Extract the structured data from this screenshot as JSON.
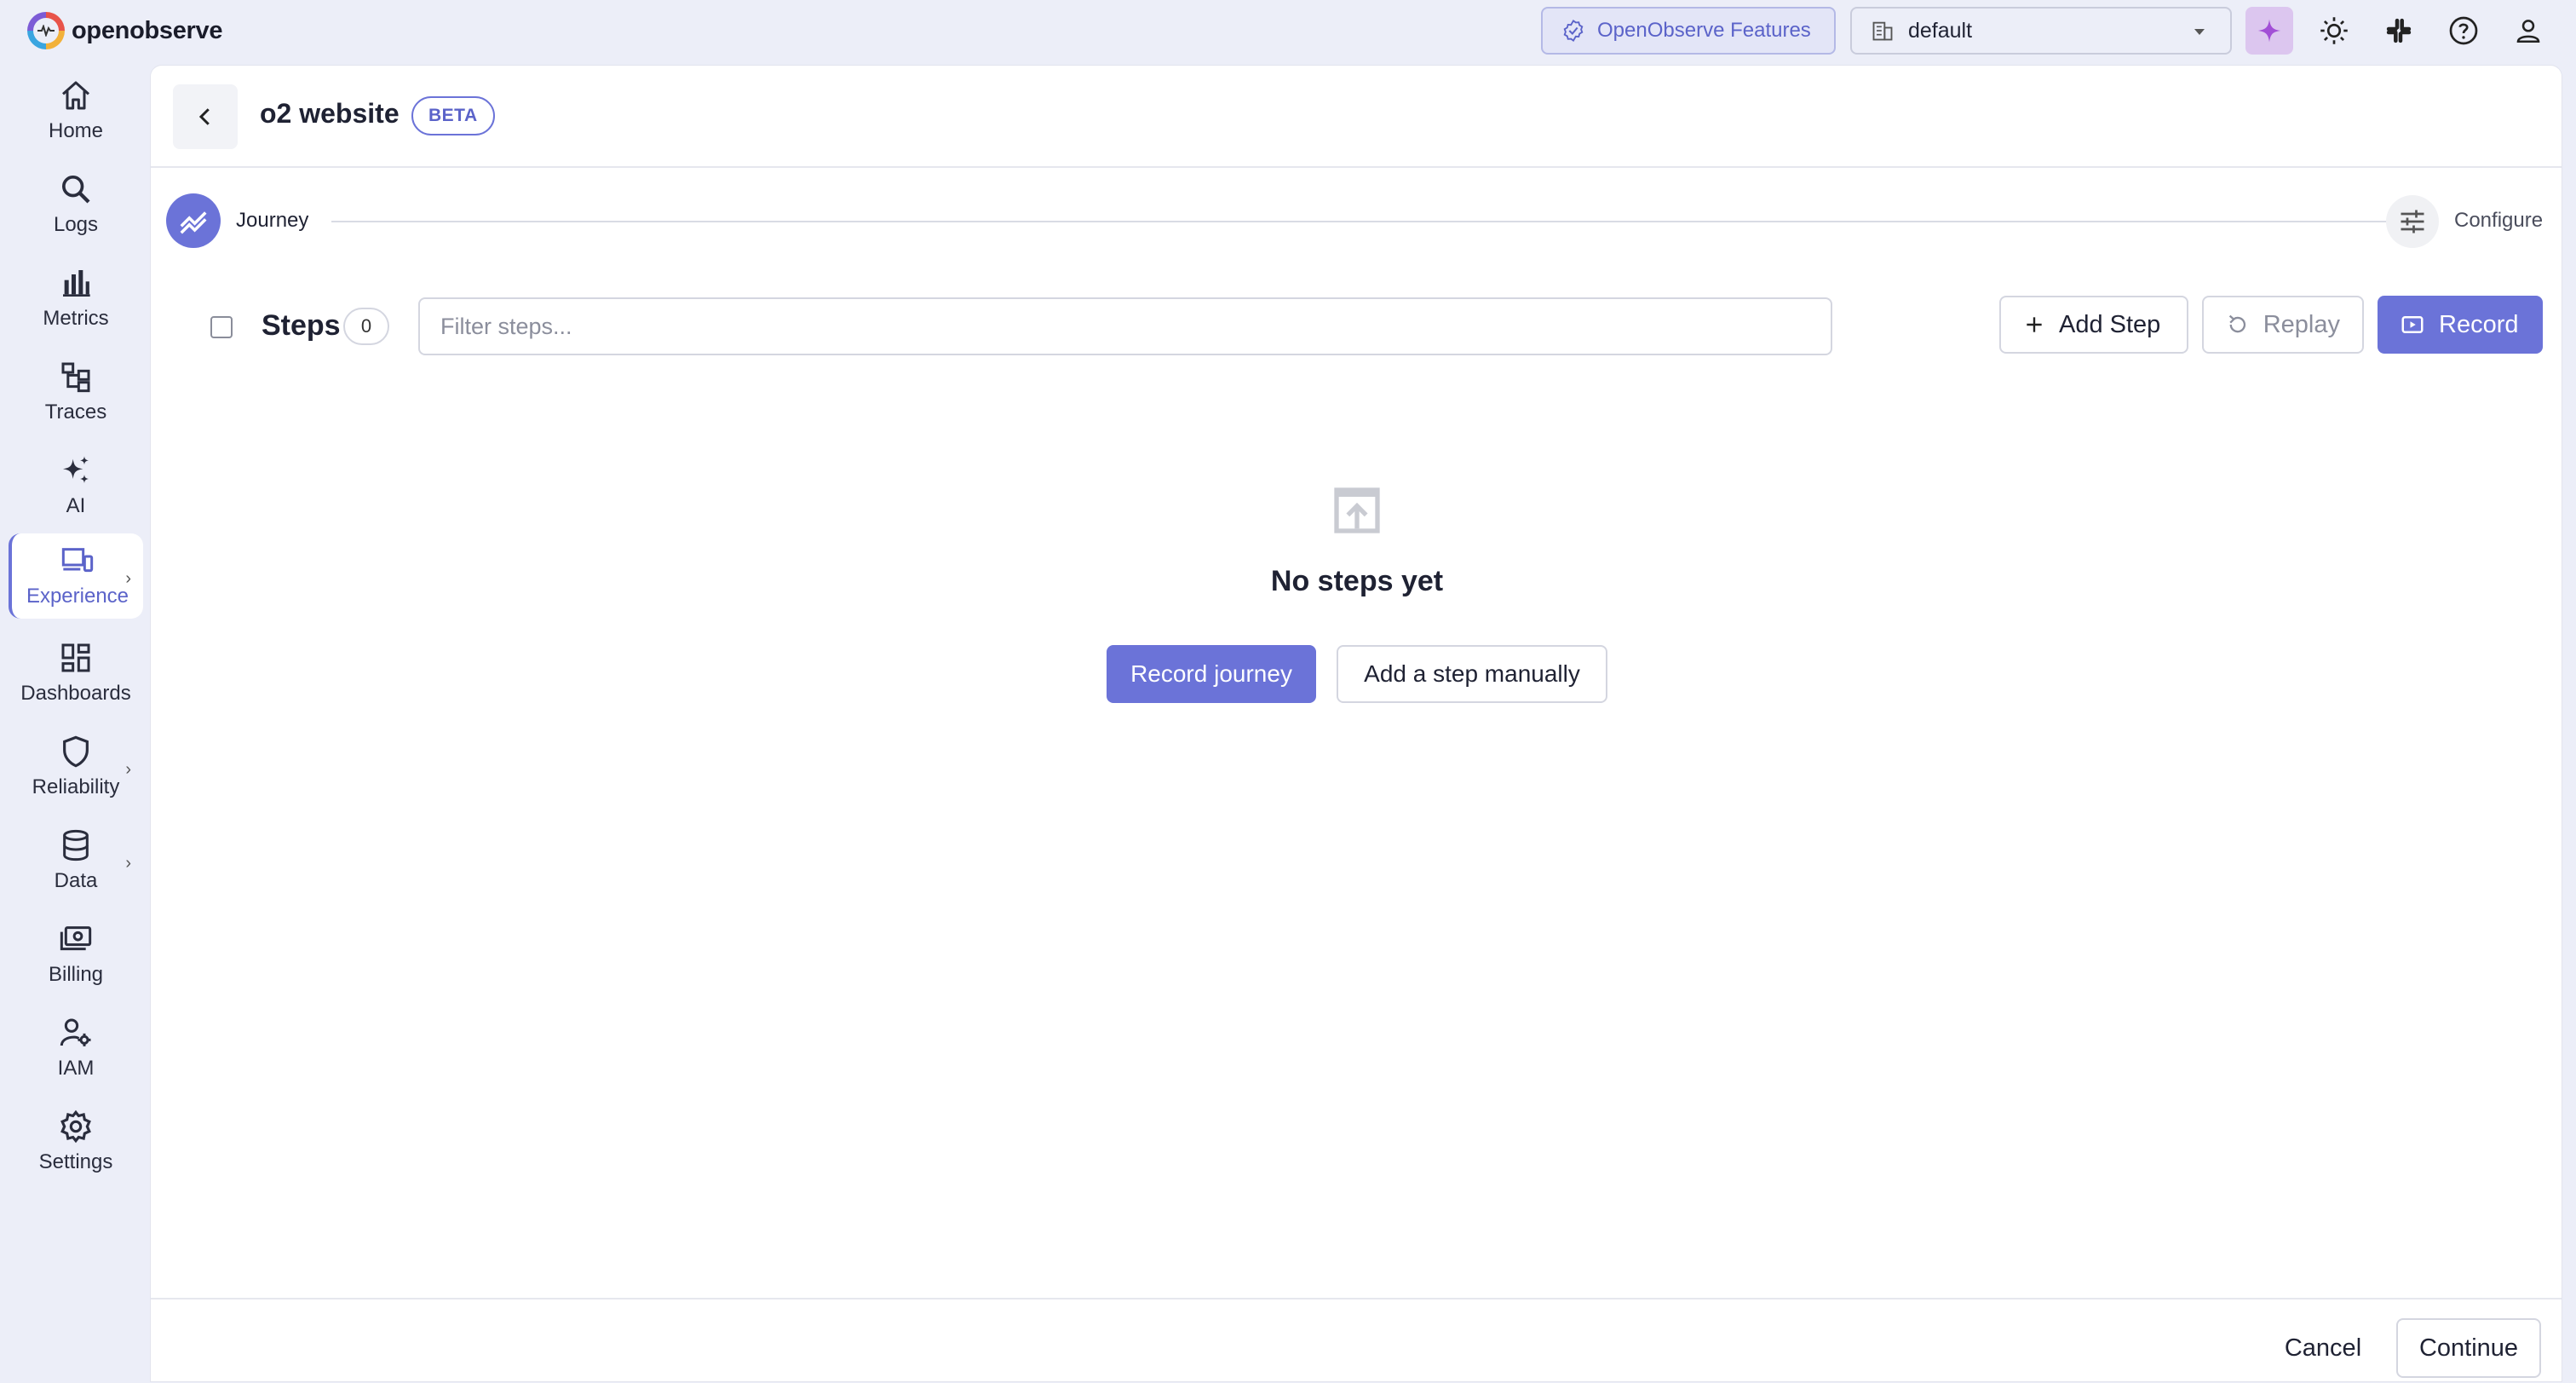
{
  "app": {
    "logo_text": "openobserve",
    "features_label": "OpenObserve Features",
    "org_selected": "default"
  },
  "sidebar": {
    "items": [
      {
        "label": "Home",
        "icon": "home-icon"
      },
      {
        "label": "Logs",
        "icon": "search-icon"
      },
      {
        "label": "Metrics",
        "icon": "bar-chart-icon"
      },
      {
        "label": "Traces",
        "icon": "traces-icon"
      },
      {
        "label": "AI",
        "icon": "sparkle-icon"
      },
      {
        "label": "Experience",
        "icon": "devices-icon",
        "active": true
      },
      {
        "label": "Dashboards",
        "icon": "dashboard-icon"
      },
      {
        "label": "Reliability",
        "icon": "shield-icon"
      },
      {
        "label": "Data",
        "icon": "database-icon"
      },
      {
        "label": "Billing",
        "icon": "billing-icon"
      },
      {
        "label": "IAM",
        "icon": "user-gear-icon"
      },
      {
        "label": "Settings",
        "icon": "gear-icon"
      }
    ]
  },
  "header": {
    "title": "o2 website",
    "badge": "BETA"
  },
  "stepper": {
    "step_label": "Journey",
    "configure_label": "Configure"
  },
  "toolbar": {
    "steps_label": "Steps",
    "steps_count": "0",
    "filter_placeholder": "Filter steps...",
    "add_step_label": "Add Step",
    "replay_label": "Replay",
    "record_label": "Record"
  },
  "empty_state": {
    "title": "No steps yet",
    "record_journey_label": "Record journey",
    "add_manual_label": "Add a step manually"
  },
  "footer": {
    "cancel_label": "Cancel",
    "continue_label": "Continue"
  },
  "colors": {
    "accent": "#6b73d8",
    "background": "#eceef8",
    "ai_button": "#dcc6ef"
  }
}
